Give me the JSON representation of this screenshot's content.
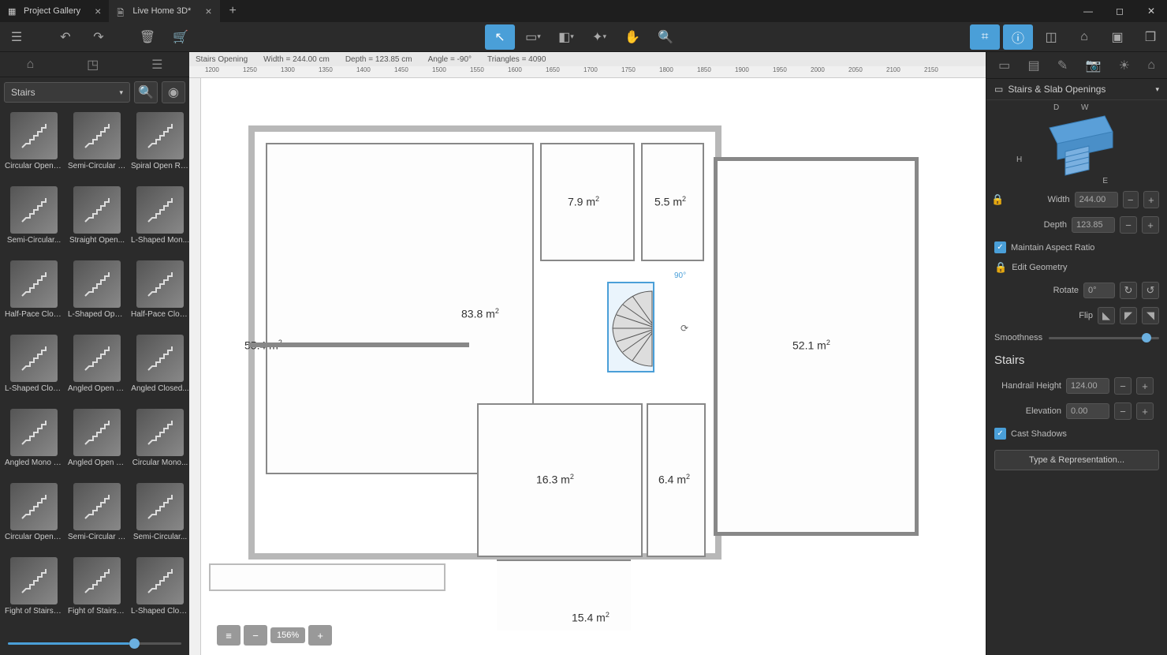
{
  "tabs": [
    {
      "label": "Project Gallery",
      "active": false
    },
    {
      "label": "Live Home 3D*",
      "active": true
    }
  ],
  "library_category": "Stairs",
  "library_items": [
    "Circular Open R...",
    "Semi-Circular O...",
    "Spiral Open Ris...",
    "Semi-Circular...",
    "Straight Open...",
    "L-Shaped Mon...",
    "Half-Pace Close...",
    "L-Shaped Open...",
    "Half-Pace Close...",
    "L-Shaped Close...",
    "Angled Open R...",
    "Angled Closed...",
    "Angled Mono S...",
    "Angled Open R...",
    "Circular Mono...",
    "Circular Open R...",
    "Semi-Circular O...",
    "Semi-Circular...",
    "Fight of Stairs 7...",
    "Fight of Stairs 8...",
    "L-Shaped Close..."
  ],
  "info": {
    "object": "Stairs Opening",
    "width": "Width = 244.00 cm",
    "depth": "Depth = 123.85 cm",
    "angle": "Angle = -90°",
    "triangles": "Triangles = 4090"
  },
  "rooms": {
    "r1": "7.9 m²",
    "r2": "5.5 m²",
    "r3": "83.8 m²",
    "r4": "55.4 m²",
    "r5": "52.1 m²",
    "r6": "16.3 m²",
    "r7": "6.4 m²",
    "r8": "15.4 m²"
  },
  "rotation_badge": "90°",
  "zoom": "156%",
  "inspector": {
    "header": "Stairs & Slab Openings",
    "d_label": "D",
    "w_label": "W",
    "h_label": "H",
    "e_label": "E",
    "width_label": "Width",
    "width_val": "244.00",
    "depth_label": "Depth",
    "depth_val": "123.85",
    "aspect": "Maintain Aspect Ratio",
    "edit_geom": "Edit Geometry",
    "rotate_label": "Rotate",
    "rotate_val": "0°",
    "flip_label": "Flip",
    "smooth_label": "Smoothness",
    "stairs_title": "Stairs",
    "handrail_label": "Handrail Height",
    "handrail_val": "124.00",
    "elev_label": "Elevation",
    "elev_val": "0.00",
    "cast_shadows": "Cast Shadows",
    "type_rep": "Type & Representation..."
  },
  "ruler_marks": [
    "1200",
    "1250",
    "1300",
    "1350",
    "1400",
    "1450",
    "1500",
    "1550",
    "1600",
    "1650",
    "1700",
    "1750",
    "1800",
    "1850",
    "1900",
    "1950",
    "2000",
    "2050",
    "2100",
    "2150"
  ]
}
